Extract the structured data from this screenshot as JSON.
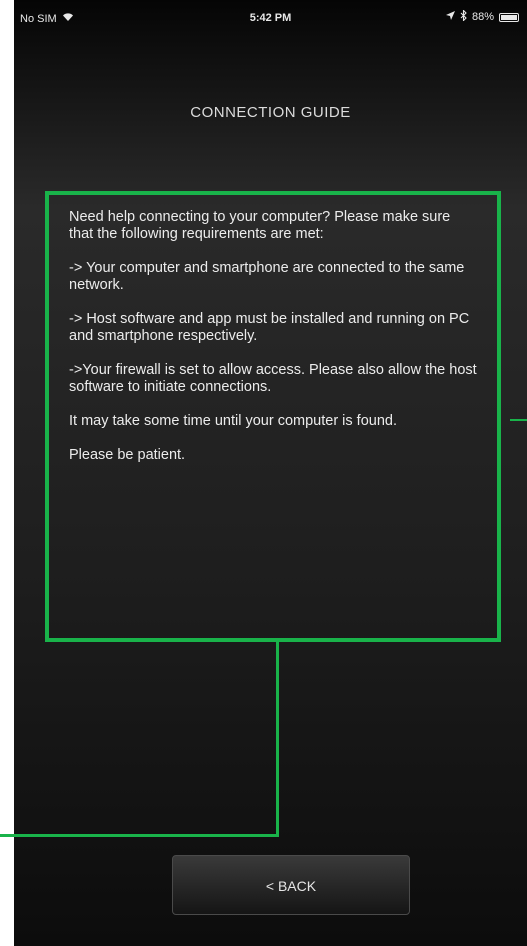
{
  "status_bar": {
    "carrier": "No SIM",
    "time": "5:42 PM",
    "battery": "88%"
  },
  "header": {
    "title": "CONNECTION GUIDE"
  },
  "guide": {
    "paragraphs": [
      "Need help connecting to your computer? Please make sure that the following requirements are met:",
      "-> Your computer and smartphone are connected to the same network.",
      "-> Host software and app must be installed and running on PC and smartphone respectively.",
      "->Your firewall is set to allow access. Please also allow the host software to initiate connections.",
      "It may take some time until your computer is found.",
      "Please be patient."
    ]
  },
  "footer": {
    "back_label": "< BACK"
  },
  "colors": {
    "highlight": "#19b34a",
    "text": "#ececec"
  },
  "icons": {
    "wifi": "wifi-icon",
    "location": "location-arrow-icon",
    "bluetooth": "bluetooth-icon",
    "battery": "battery-icon"
  }
}
